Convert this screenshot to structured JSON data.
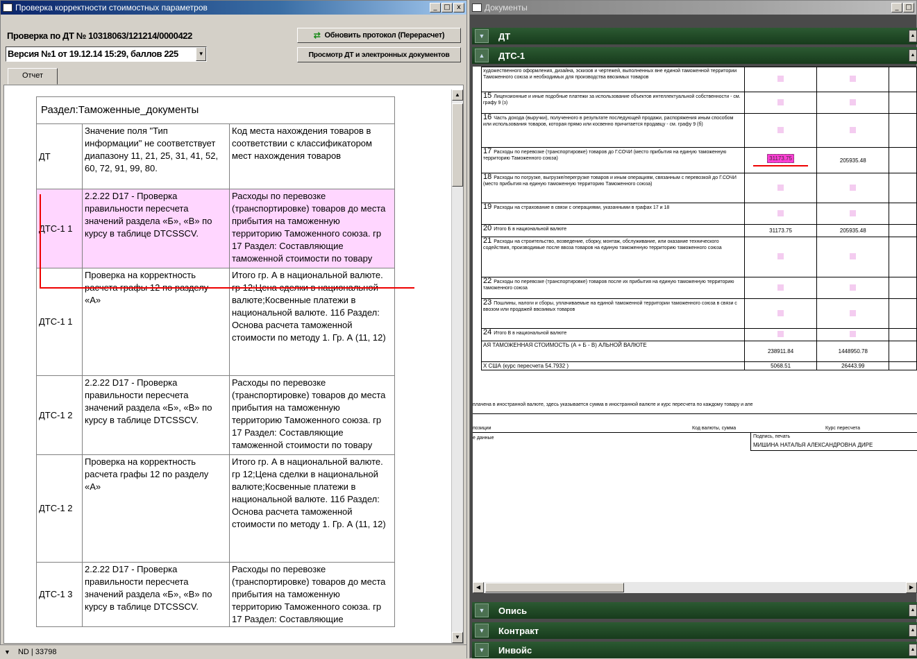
{
  "left_window": {
    "title": "Проверка корректности стоимостных параметров",
    "controls": [
      "_",
      "□",
      "x"
    ],
    "dt_label": "Проверка по ДТ № 10318063/121214/0000422",
    "refresh_button": "Обновить протокол (Перерасчет)",
    "view_button": "Просмотр ДТ и электронных документов",
    "version_select": "Версия №1 от 19.12.14 15:29, баллов 225",
    "tab": "Отчет",
    "report": {
      "section_header": "Раздел:Таможенные_документы",
      "rows": [
        {
          "doc": "ДТ",
          "check": "Значение поля \"Тип информации\" не соответствует диапазону 11, 21, 25, 31, 41, 52, 60, 72, 91, 99, 80.",
          "field": "Код места нахождения товаров в соответствии с классификатором мест нахождения товаров",
          "highlight": false
        },
        {
          "doc": "ДТС-1 1",
          "check": "2.2.22 D17 - Проверка правильности пересчета значений раздела «Б», «В» по курсу в таблице DTCSSCV.",
          "field": "Расходы по перевозке (транспортировке) товаров до места прибытия на таможенную территорию Таможенного союза. гр 17 Раздел: Составляющие таможенной стоимости по товару",
          "highlight": true
        },
        {
          "doc": "ДТС-1 1",
          "check": "Проверка на корректность расчета графы 12 по разделу «А»",
          "field": "Итого гр. А в национальной валюте. гр 12;Цена сделки в национальной валюте;Косвенные платежи в национальной валюте. 11б Раздел: Основа расчета таможенной стоимости по методу 1. Гр. А (11, 12)",
          "highlight": false
        },
        {
          "doc": "ДТС-1 2",
          "check": "2.2.22 D17 - Проверка правильности пересчета значений раздела «Б», «В» по курсу в таблице DTCSSCV.",
          "field": "Расходы по перевозке (транспортировке) товаров до места прибытия на таможенную территорию Таможенного союза. гр 17 Раздел: Составляющие таможенной стоимости по товару",
          "highlight": false
        },
        {
          "doc": "ДТС-1 2",
          "check": "Проверка на корректность расчета графы 12 по разделу «А»",
          "field": "Итого гр. А в национальной валюте. гр 12;Цена сделки в национальной валюте;Косвенные платежи в национальной валюте. 11б Раздел: Основа расчета таможенной стоимости по методу 1. Гр. А (11, 12)",
          "highlight": false
        },
        {
          "doc": "ДТС-1 3",
          "check": "2.2.22 D17 - Проверка правильности пересчета значений раздела «Б», «В» по курсу в таблице DTCSSCV.",
          "field": "Расходы по перевозке (транспортировке) товаров до места прибытия на таможенную территорию Таможенного союза. гр 17 Раздел: Составляющие",
          "highlight": false
        }
      ]
    },
    "status": "ND | 33798"
  },
  "right_window": {
    "title": "Документы",
    "sections_top": [
      {
        "label": "ДТ",
        "expanded": false
      },
      {
        "label": "ДТС-1",
        "expanded": true
      }
    ],
    "doc_rows": [
      {
        "no": "",
        "text": "художественного оформления, дизайна, эскизов и чертежей, выполненных вне единой таможенной территории Таможенного союза и необходимых для производства ввозимых товаров",
        "v1": "",
        "v2": ""
      },
      {
        "no": "15",
        "text": "Лицензионные и иные подобные платежи за использование объектов интеллектуальной собственности - см. графу 9 (з)",
        "v1": "",
        "v2": ""
      },
      {
        "no": "16",
        "text": "Часть дохода (выручки), полученного в результате последующей продажи, распоряжения иным способом или использования товаров, которая прямо или косвенно причитается продавцу - см. графу 9 (б)",
        "v1": "",
        "v2": ""
      },
      {
        "no": "17",
        "text": "Расходы по перевозке (транспортировке) товаров до Г.СОЧИ (место прибытия на единую таможенную территорию Таможенного союза)",
        "v1": "31173.75",
        "v2": "205935.48",
        "selected": true
      },
      {
        "no": "18",
        "text": "Расходы по погрузке, выгрузке/перегрузке товаров и иным операциям, связанным с перевозкой до Г.СОЧИ (место прибытия на единую таможенную территорию Таможенного союза)",
        "v1": "",
        "v2": ""
      },
      {
        "no": "19",
        "text": "Расходы на страхование в связи с операциями, указанными в графах 17 и 18",
        "v1": "",
        "v2": ""
      },
      {
        "no": "20",
        "text": "Итого Б в национальной валюте",
        "v1": "31173.75",
        "v2": "205935.48"
      },
      {
        "no": "21",
        "text": "Расходы на строительство, возведение, сборку, монтаж, обслуживание, или оказание технического содействия, производимые после ввоза товаров на единую таможенную территорию таможенного союза",
        "v1": "",
        "v2": ""
      },
      {
        "no": "22",
        "text": "Расходы по перевозке (транспортировке) товаров после их прибытия на единую таможенную территорию таможенного союза",
        "v1": "",
        "v2": ""
      },
      {
        "no": "23",
        "text": "Пошлины, налоги и сборы, уплачиваемые на единой таможенной территории таможенного союза в связи с ввозом или продажей ввозимых товаров",
        "v1": "",
        "v2": ""
      },
      {
        "no": "24",
        "text": "Итого В в национальной валюте",
        "v1": "",
        "v2": ""
      },
      {
        "no": "",
        "text": "АЯ ТАМОЖЕННАЯ СТОИМОСТЬ (А + Б - В) АЛЬНОЙ ВАЛЮТЕ",
        "v1": "238911.84",
        "v2": "1448950.78"
      },
      {
        "no": "",
        "text": "Х США (курс пересчета 54.7932 )",
        "v1": "5068.51",
        "v2": "26443.99"
      }
    ],
    "footnote": "плачена в иностранной валюте, здесь указывается сумма в иностранной валюте и курс пересчета по каждому товару и апе",
    "footer_cols": [
      "позиции",
      "Код валюты, сумма",
      "Курс пересчета"
    ],
    "footer_left": "е данные",
    "signature_label": "Подпись, печать",
    "signature_name": "МИШИНА НАТАЛЬЯ АЛЕКСАНДРОВНА ДИРЕ",
    "sections_bottom": [
      "Опись",
      "Контракт",
      "Инвойс"
    ]
  },
  "colors": {
    "highlight_row": "#ffd6ff",
    "selected_value": "#ff3fd6",
    "section_bar": "#1f4a24",
    "annotation_red": "#e00000"
  }
}
